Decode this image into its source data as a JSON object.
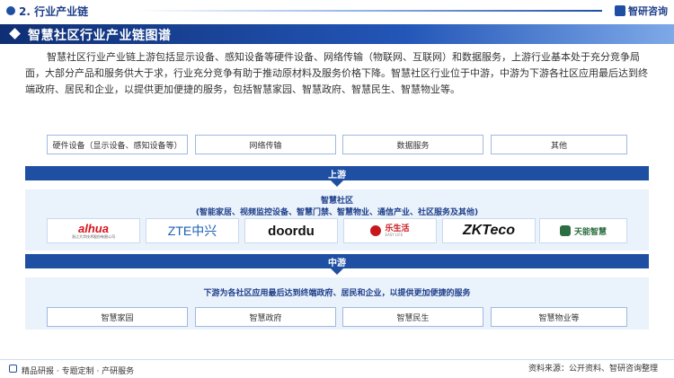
{
  "header": {
    "section_title": "2. 行业产业链",
    "brand": "智研咨询"
  },
  "banner": {
    "title": "智慧社区行业产业链图谱"
  },
  "intro": "智慧社区行业产业链上游包括显示设备、感知设备等硬件设备、网络传输（物联网、互联网）和数据服务，上游行业基本处于充分竞争局面，大部分产品和服务供大于求，行业充分竞争有助于推动原材料及服务价格下降。智慧社区行业位于中游，中游为下游各社区应用最后达到终端政府、居民和企业，以提供更加便捷的服务，包括智慧家园、智慧政府、智慧民生、智慧物业等。",
  "upstream": {
    "items": [
      "硬件设备（显示设备、感知设备等）",
      "网络传输",
      "数据服务",
      "其他"
    ],
    "band_label": "上游"
  },
  "midstream": {
    "title": "智慧社区",
    "subtitle": "(智能家居、视频监控设备、智慧门禁、智慧物业、通信产业、社区服务及其他)",
    "logos": [
      {
        "name": "alhua",
        "sub": "浙江大华技术股份有限公司",
        "color": "#d7141a"
      },
      {
        "name": "ZTE中兴",
        "color": "#1a5fb4"
      },
      {
        "name": "doordu",
        "color": "#111111"
      },
      {
        "name": "乐生活",
        "sub": "EASY LIFE",
        "color": "#c8161d"
      },
      {
        "name": "ZKTeco",
        "color": "#111111",
        "accent": "#2ea043"
      },
      {
        "name": "天能智慧",
        "color": "#2b6e3f"
      }
    ],
    "band_label": "中游"
  },
  "downstream": {
    "title": "下游为各社区应用最后达到终端政府、居民和企业，以提供更加便捷的服务",
    "items": [
      "智慧家园",
      "智慧政府",
      "智慧民生",
      "智慧物业等"
    ]
  },
  "footer": {
    "left": "精品研报 · 专题定制 · 产研服务",
    "right": "资料来源：公开资料、智研咨询整理"
  },
  "colors": {
    "primary": "#1e4fa3",
    "dark": "#0f2f74",
    "panel": "#eaf2fc"
  }
}
